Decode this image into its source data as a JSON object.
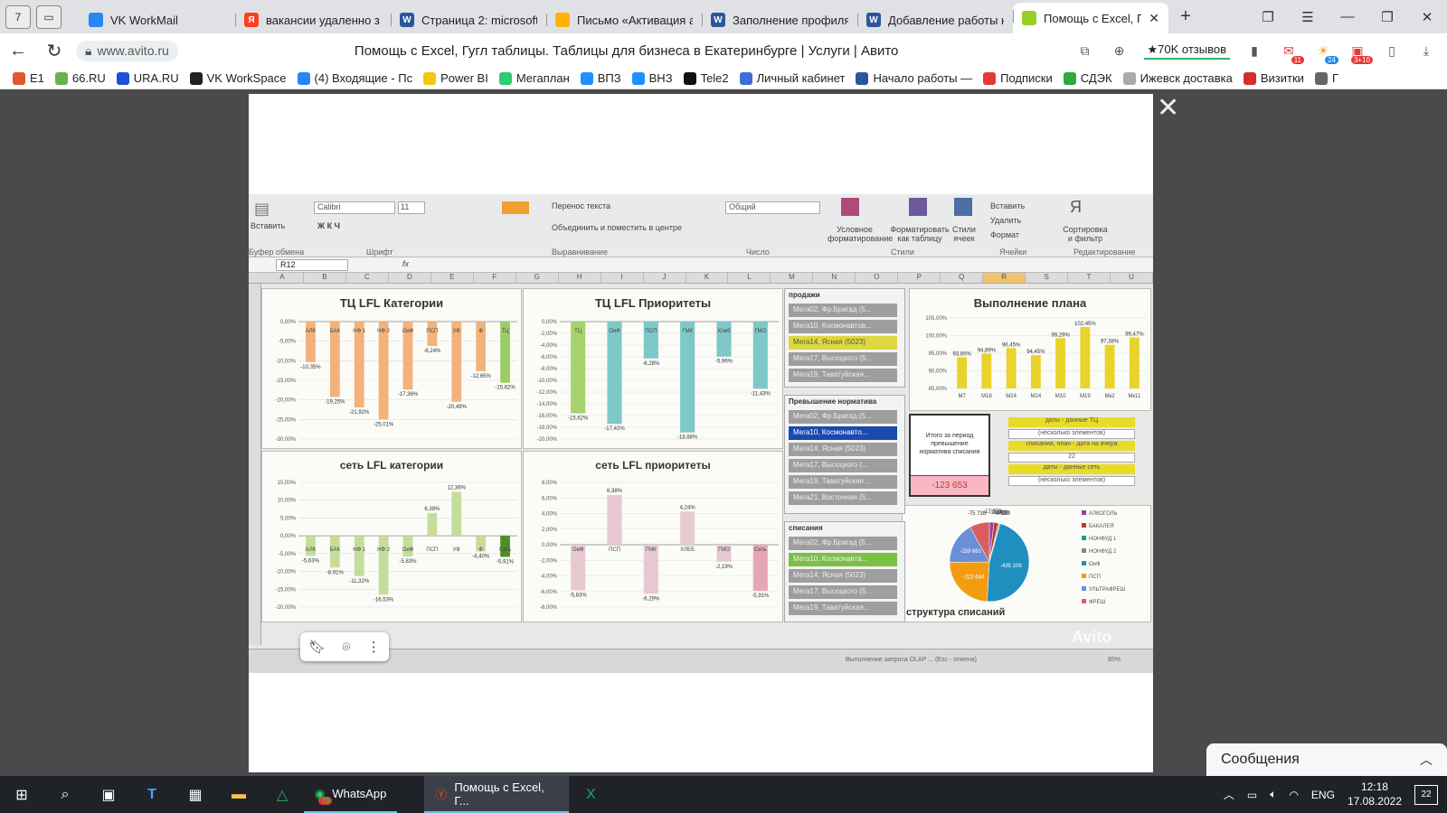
{
  "tabs": [
    {
      "title": "VK WorkMail",
      "icon_color": "#2787f5",
      "icon": "mail-icon"
    },
    {
      "title": "вакансии удаленно з",
      "icon_color": "#fc3f1d",
      "icon": "yandex-icon",
      "glyph": "Я"
    },
    {
      "title": "Страница 2: microsoft",
      "icon_color": "#2b579a",
      "icon": "word-icon",
      "glyph": "W"
    },
    {
      "title": "Письмо «Активация а",
      "icon_color": "#ffb300",
      "icon": "mail-envelope-icon"
    },
    {
      "title": "Заполнение профиля",
      "icon_color": "#2b579a",
      "icon": "word-icon",
      "glyph": "W"
    },
    {
      "title": "Добавление работы н",
      "icon_color": "#2b579a",
      "icon": "word-icon",
      "glyph": "W"
    },
    {
      "title": "Помощь с Excel, Гу",
      "icon_color": "#97cf26",
      "icon": "avito-icon",
      "active": true
    }
  ],
  "tab_counter": "7",
  "address": {
    "url": "www.avito.ru",
    "page_title": "Помощь с Excel, Гугл таблицы. Таблицы для бизнеса в Екатеринбурге | Услуги | Авито",
    "reviews": "★70K отзывов",
    "badge_mail": "11",
    "badge_weather": "24",
    "badge_red": "3+10"
  },
  "bookmarks": [
    {
      "label": "E1",
      "color": "#e4572e"
    },
    {
      "label": "66.RU",
      "color": "#6ab04c"
    },
    {
      "label": "URA.RU",
      "color": "#1e4fd8"
    },
    {
      "label": "VK WorkSpace",
      "color": "#222"
    },
    {
      "label": "(4) Входящие - Пс",
      "color": "#2787f5"
    },
    {
      "label": "Power BI",
      "color": "#f2c811"
    },
    {
      "label": "Мегаплан",
      "color": "#2ecc71"
    },
    {
      "label": "ВПЗ",
      "color": "#1e90ff"
    },
    {
      "label": "ВНЗ",
      "color": "#1e90ff"
    },
    {
      "label": "Tele2",
      "color": "#111"
    },
    {
      "label": "Личный кабинет",
      "color": "#3b6fd6"
    },
    {
      "label": "Начало работы —",
      "color": "#2b579a"
    },
    {
      "label": "Подписки",
      "color": "#e53935"
    },
    {
      "label": "СДЭК",
      "color": "#2eaa3f"
    },
    {
      "label": "Ижевск доставка",
      "color": "#aaa"
    },
    {
      "label": "Визитки",
      "color": "#d32f2f"
    },
    {
      "label": "Г",
      "color": "#666"
    }
  ],
  "ribbon": {
    "font": "Calibri",
    "size": "11",
    "number_format": "Общий",
    "wrap_text": "Перенос текста",
    "merge_center": "Объединить и поместить в центре",
    "insert_btn": "Вставить",
    "cond_format": "Условное форматирование",
    "format_table": "Форматировать как таблицу",
    "cell_styles": "Стили ячеек",
    "insert_cells": "Вставить",
    "delete_cells": "Удалить",
    "format_cells": "Формат",
    "sort_filter": "Сортировка и фильтр",
    "groups": [
      "Буфер обмена",
      "Шрифт",
      "Выравнивание",
      "Число",
      "Стили",
      "Ячейки",
      "Редактирование"
    ],
    "name_box": "R12"
  },
  "columns": [
    "A",
    "B",
    "C",
    "D",
    "E",
    "F",
    "G",
    "H",
    "I",
    "J",
    "K",
    "L",
    "M",
    "N",
    "O",
    "P",
    "Q",
    "R",
    "S",
    "T",
    "U"
  ],
  "selected_column": "R",
  "charts": {
    "tc_cat": {
      "title": "ТЦ LFL Категории",
      "categories": [
        "АЛК",
        "БАК",
        "НФ 1",
        "НФ 2",
        "ОиФ",
        "ПСП",
        "УФ",
        "Ф",
        "ТЦ"
      ],
      "values": [
        -10.35,
        -19.25,
        -21.92,
        -25.01,
        -17.36,
        -6.24,
        -20.49,
        -12.65,
        -15.62
      ],
      "labels": [
        "-10,35%",
        "-19,25%",
        "-21,92%",
        "-25,01%",
        "-17,36%",
        "-6,24%",
        "-20,49%",
        "-12,65%",
        "-15,62%"
      ],
      "yticks": [
        "0,00%",
        "-5,00%",
        "-10,00%",
        "-15,00%",
        "-20,00%",
        "-25,00%",
        "-30,00%"
      ],
      "color": "#f2b27a",
      "last_color": "#9ccc65"
    },
    "tc_pri": {
      "title": "ТЦ LFL Приоритеты",
      "categories": [
        "ТЦ",
        "ОиФ",
        "ПСП",
        "ГМК",
        "Хлеб",
        "ГМО"
      ],
      "values": [
        -15.62,
        -17.42,
        -6.28,
        -18.88,
        -5.96,
        -11.43
      ],
      "labels": [
        "-15,62%",
        "-17,42%",
        "-6,28%",
        "-18,88%",
        "-5,96%",
        "-11,43%"
      ],
      "yticks": [
        "0,00%",
        "-2,00%",
        "-4,00%",
        "-6,00%",
        "-8,00%",
        "-10,00%",
        "-12,00%",
        "-14,00%",
        "-16,00%",
        "-18,00%",
        "-20,00%"
      ],
      "color": "#7ec8c8",
      "first_color": "#a6d36b"
    },
    "net_cat": {
      "title": "сеть LFL категории",
      "categories": [
        "АЛК",
        "БАК",
        "НФ 1",
        "НФ 2",
        "ОиФ",
        "ПСП",
        "УФ",
        "Ф",
        "Сеть"
      ],
      "values": [
        -5.63,
        -8.91,
        -11.32,
        -16.53,
        -5.83,
        6.38,
        12.36,
        -4.4,
        -5.91
      ],
      "labels": [
        "-5,63%",
        "-8,91%",
        "-11,32%",
        "-16,53%",
        "-5,83%",
        "6,38%",
        "12,36%",
        "-4,40%",
        "-5,91%"
      ],
      "yticks": [
        "15,00%",
        "10,00%",
        "5,00%",
        "0,00%",
        "-5,00%",
        "-10,00%",
        "-15,00%",
        "-20,00%"
      ],
      "color": "#c5dd9a",
      "last_color": "#4e8f2a"
    },
    "net_pri": {
      "title": "сеть LFL приоритеты",
      "categories": [
        "ОиФ",
        "ПСП",
        "ГМК",
        "ХЛЕБ",
        "ГМО",
        "Сеть"
      ],
      "values": [
        -5.83,
        6.38,
        -6.29,
        4.24,
        -2.19,
        -5.91
      ],
      "labels": [
        "-5,83%",
        "6,38%",
        "-6,29%",
        "4,24%",
        "-2,19%",
        "-5,91%"
      ],
      "yticks": [
        "8,00%",
        "6,00%",
        "4,00%",
        "2,00%",
        "0,00%",
        "-2,00%",
        "-4,00%",
        "-6,00%",
        "-8,00%"
      ],
      "color": "#e7c9d2",
      "last_color": "#e5a7b8"
    },
    "plan": {
      "title": "Выполнение плана",
      "categories": [
        "М7",
        "М18",
        "М24",
        "М24",
        "М10",
        "М19",
        "Мк2",
        "Мк11"
      ],
      "values": [
        93.85,
        94.89,
        96.45,
        94.45,
        99.29,
        102.45,
        97.38,
        99.47
      ],
      "labels": [
        "93,85%",
        "94,89%",
        "96,45%",
        "94,45%",
        "99,29%",
        "102,45%",
        "97,38%",
        "99,47%"
      ],
      "yticks": [
        "105,00%",
        "100,00%",
        "95,00%",
        "90,00%",
        "85,00%"
      ],
      "color": "#e8d42a"
    },
    "pie": {
      "title": "структура списаний",
      "values": [
        17579,
        15908,
        3910,
        4280,
        435109,
        223694,
        159661,
        75738
      ],
      "labels": [
        "-17 579",
        "-15 908",
        "-3 910",
        "-4 280",
        "-435 109",
        "-223 694",
        "-159 661",
        "-75 738"
      ],
      "colors": [
        "#8e44ad",
        "#c0392b",
        "#16a085",
        "#7f8c8d",
        "#1f8fbf",
        "#f39c12",
        "#6b8fd6",
        "#d95f5f"
      ],
      "legend": [
        "АЛКОГОЛЬ",
        "БАКАЛЕЯ",
        "НОНФУД 1",
        "НОНФУД 2",
        "ОиФ",
        "ПСП",
        "УЛЬТРАФРЕШ",
        "ФРЕШ"
      ]
    }
  },
  "slicers": {
    "sales": {
      "title": "продажи",
      "items": [
        "Мега02, Фр.Бригад (5...",
        "Мега10, Космонавтов...",
        "Мега14, Ясная (5023)",
        "Мега17, Высоцкого (5...",
        "Мега19, Таватуйская..."
      ],
      "highlight": 2
    },
    "excess": {
      "title": "Превышение норматива",
      "items": [
        "Мега02, Фр.Бригад (5...",
        "Мега10, Космонавто...",
        "Мега14, Ясная (5023)",
        "Мега17, Высоцкого (...",
        "Мега19, Таватуйская ...",
        "Мега21, Восточная (5..."
      ],
      "highlight": 1
    },
    "writeoff": {
      "title": "списания",
      "items": [
        "Мега02, Фр.Бригад (5...",
        "Мега10, Космонавта...",
        "Мега14, Ясная (5023)",
        "Мега17, Высоцкого (5...",
        "Мега19, Таватуйская..."
      ],
      "highlight": 1
    }
  },
  "kpi": {
    "label": "Итого за период превышение норматива списания",
    "value": "-123 653"
  },
  "filters": [
    {
      "text": "даты - данные ТЦ",
      "style": "y"
    },
    {
      "text": "(несколько элементов)",
      "style": "w"
    },
    {
      "text": "списания, план - дата на вчера",
      "style": "y"
    },
    {
      "text": "22",
      "style": "w"
    },
    {
      "text": "даты - данные сеть",
      "style": "y"
    },
    {
      "text": "(несколько элементов)",
      "style": "w"
    }
  ],
  "status_text": "Выполнение запроса OLAP ... (Esc - отмена)",
  "zoom": "85%",
  "watermark": "Avito",
  "messages_label": "Сообщения",
  "taskbar": {
    "whatsapp": "WhatsApp",
    "whatsapp_badge": "79",
    "browser": "Помощь с Excel, Г...",
    "lang": "ENG",
    "time": "12:18",
    "date": "17.08.2022",
    "notif_count": "22"
  }
}
